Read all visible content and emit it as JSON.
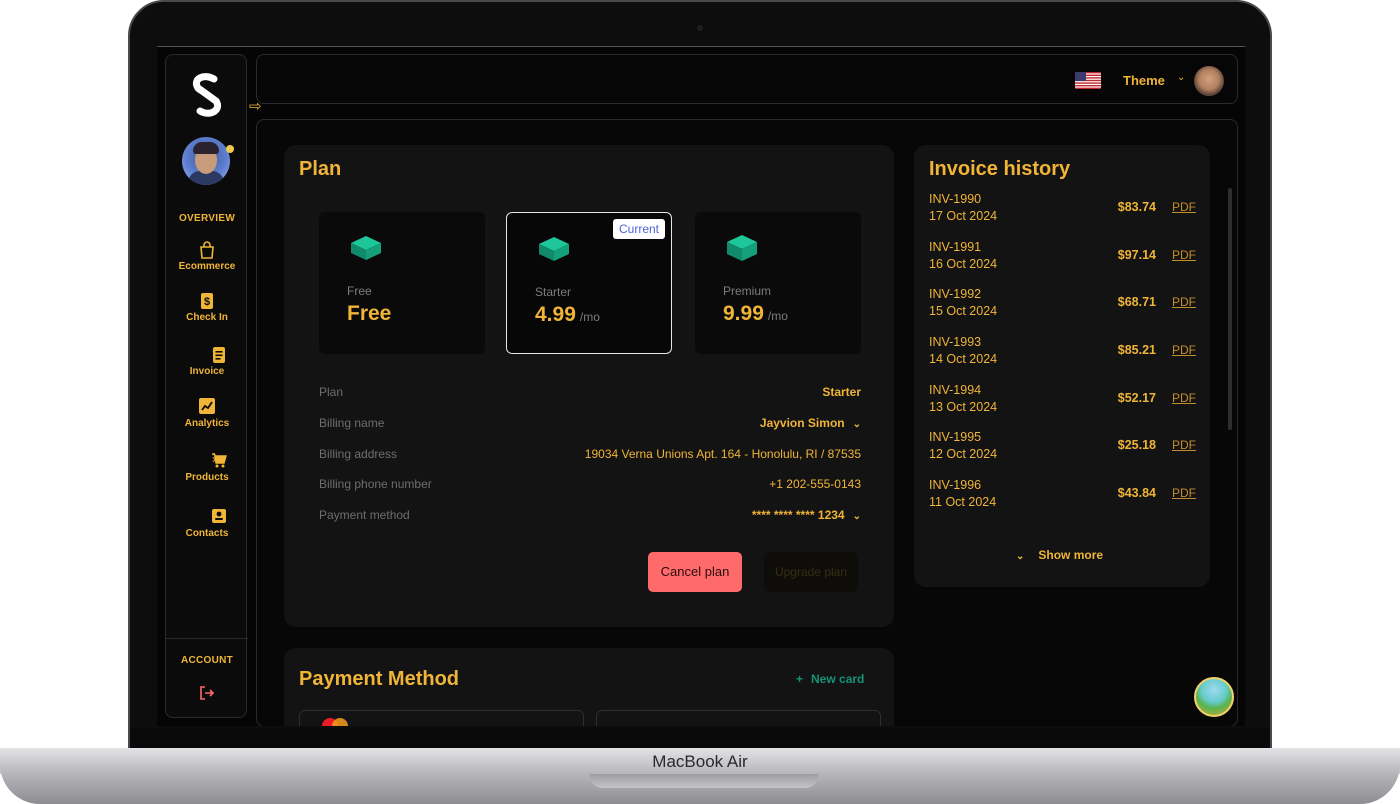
{
  "device": {
    "label": "MacBook Air"
  },
  "sidebar": {
    "sections": {
      "overview": "OVERVIEW",
      "account": "ACCOUNT"
    },
    "items": [
      {
        "label": "Ecommerce",
        "icon": "shopping-bag-icon",
        "has_children": false
      },
      {
        "label": "Check In",
        "icon": "receipt-dollar-icon",
        "has_children": false
      },
      {
        "label": "Invoice",
        "icon": "document-icon",
        "has_children": true
      },
      {
        "label": "Analytics",
        "icon": "chart-icon",
        "has_children": false
      },
      {
        "label": "Products",
        "icon": "cart-icon",
        "has_children": true
      },
      {
        "label": "Contacts",
        "icon": "contact-card-icon",
        "has_children": true
      }
    ]
  },
  "topbar": {
    "theme_label": "Theme",
    "language_flag": "us-flag-icon"
  },
  "plan": {
    "title": "Plan",
    "tiers": [
      {
        "name": "Free",
        "price": "Free",
        "period": ""
      },
      {
        "name": "Starter",
        "price": "4.99",
        "period": "/mo",
        "current": true
      },
      {
        "name": "Premium",
        "price": "9.99",
        "period": "/mo"
      }
    ],
    "current_badge": "Current",
    "details": [
      {
        "label": "Plan",
        "value": "Starter"
      },
      {
        "label": "Billing name",
        "value": "Jayvion Simon"
      },
      {
        "label": "Billing address",
        "value": "19034 Verna Unions Apt. 164 - Honolulu, RI / 87535"
      },
      {
        "label": "Billing phone number",
        "value": "+1 202-555-0143"
      },
      {
        "label": "Payment method",
        "value": "**** **** **** 1234"
      }
    ],
    "cancel_label": "Cancel plan",
    "upgrade_label": "Upgrade plan"
  },
  "payment_method": {
    "title": "Payment Method",
    "new_card_label": "New card"
  },
  "invoice_history": {
    "title": "Invoice history",
    "rows": [
      {
        "id": "INV-1990",
        "date": "17 Oct 2024",
        "amount": "$83.74",
        "link": "PDF"
      },
      {
        "id": "INV-1991",
        "date": "16 Oct 2024",
        "amount": "$97.14",
        "link": "PDF"
      },
      {
        "id": "INV-1992",
        "date": "15 Oct 2024",
        "amount": "$68.71",
        "link": "PDF"
      },
      {
        "id": "INV-1993",
        "date": "14 Oct 2024",
        "amount": "$85.21",
        "link": "PDF"
      },
      {
        "id": "INV-1994",
        "date": "13 Oct 2024",
        "amount": "$52.17",
        "link": "PDF"
      },
      {
        "id": "INV-1995",
        "date": "12 Oct 2024",
        "amount": "$25.18",
        "link": "PDF"
      },
      {
        "id": "INV-1996",
        "date": "11 Oct 2024",
        "amount": "$43.84",
        "link": "PDF"
      }
    ],
    "show_more_label": "Show more"
  },
  "colors": {
    "accent": "#f0b437",
    "danger": "#ff6a6a",
    "success": "#169275",
    "cube": "#16a37f",
    "background": "#050505"
  }
}
